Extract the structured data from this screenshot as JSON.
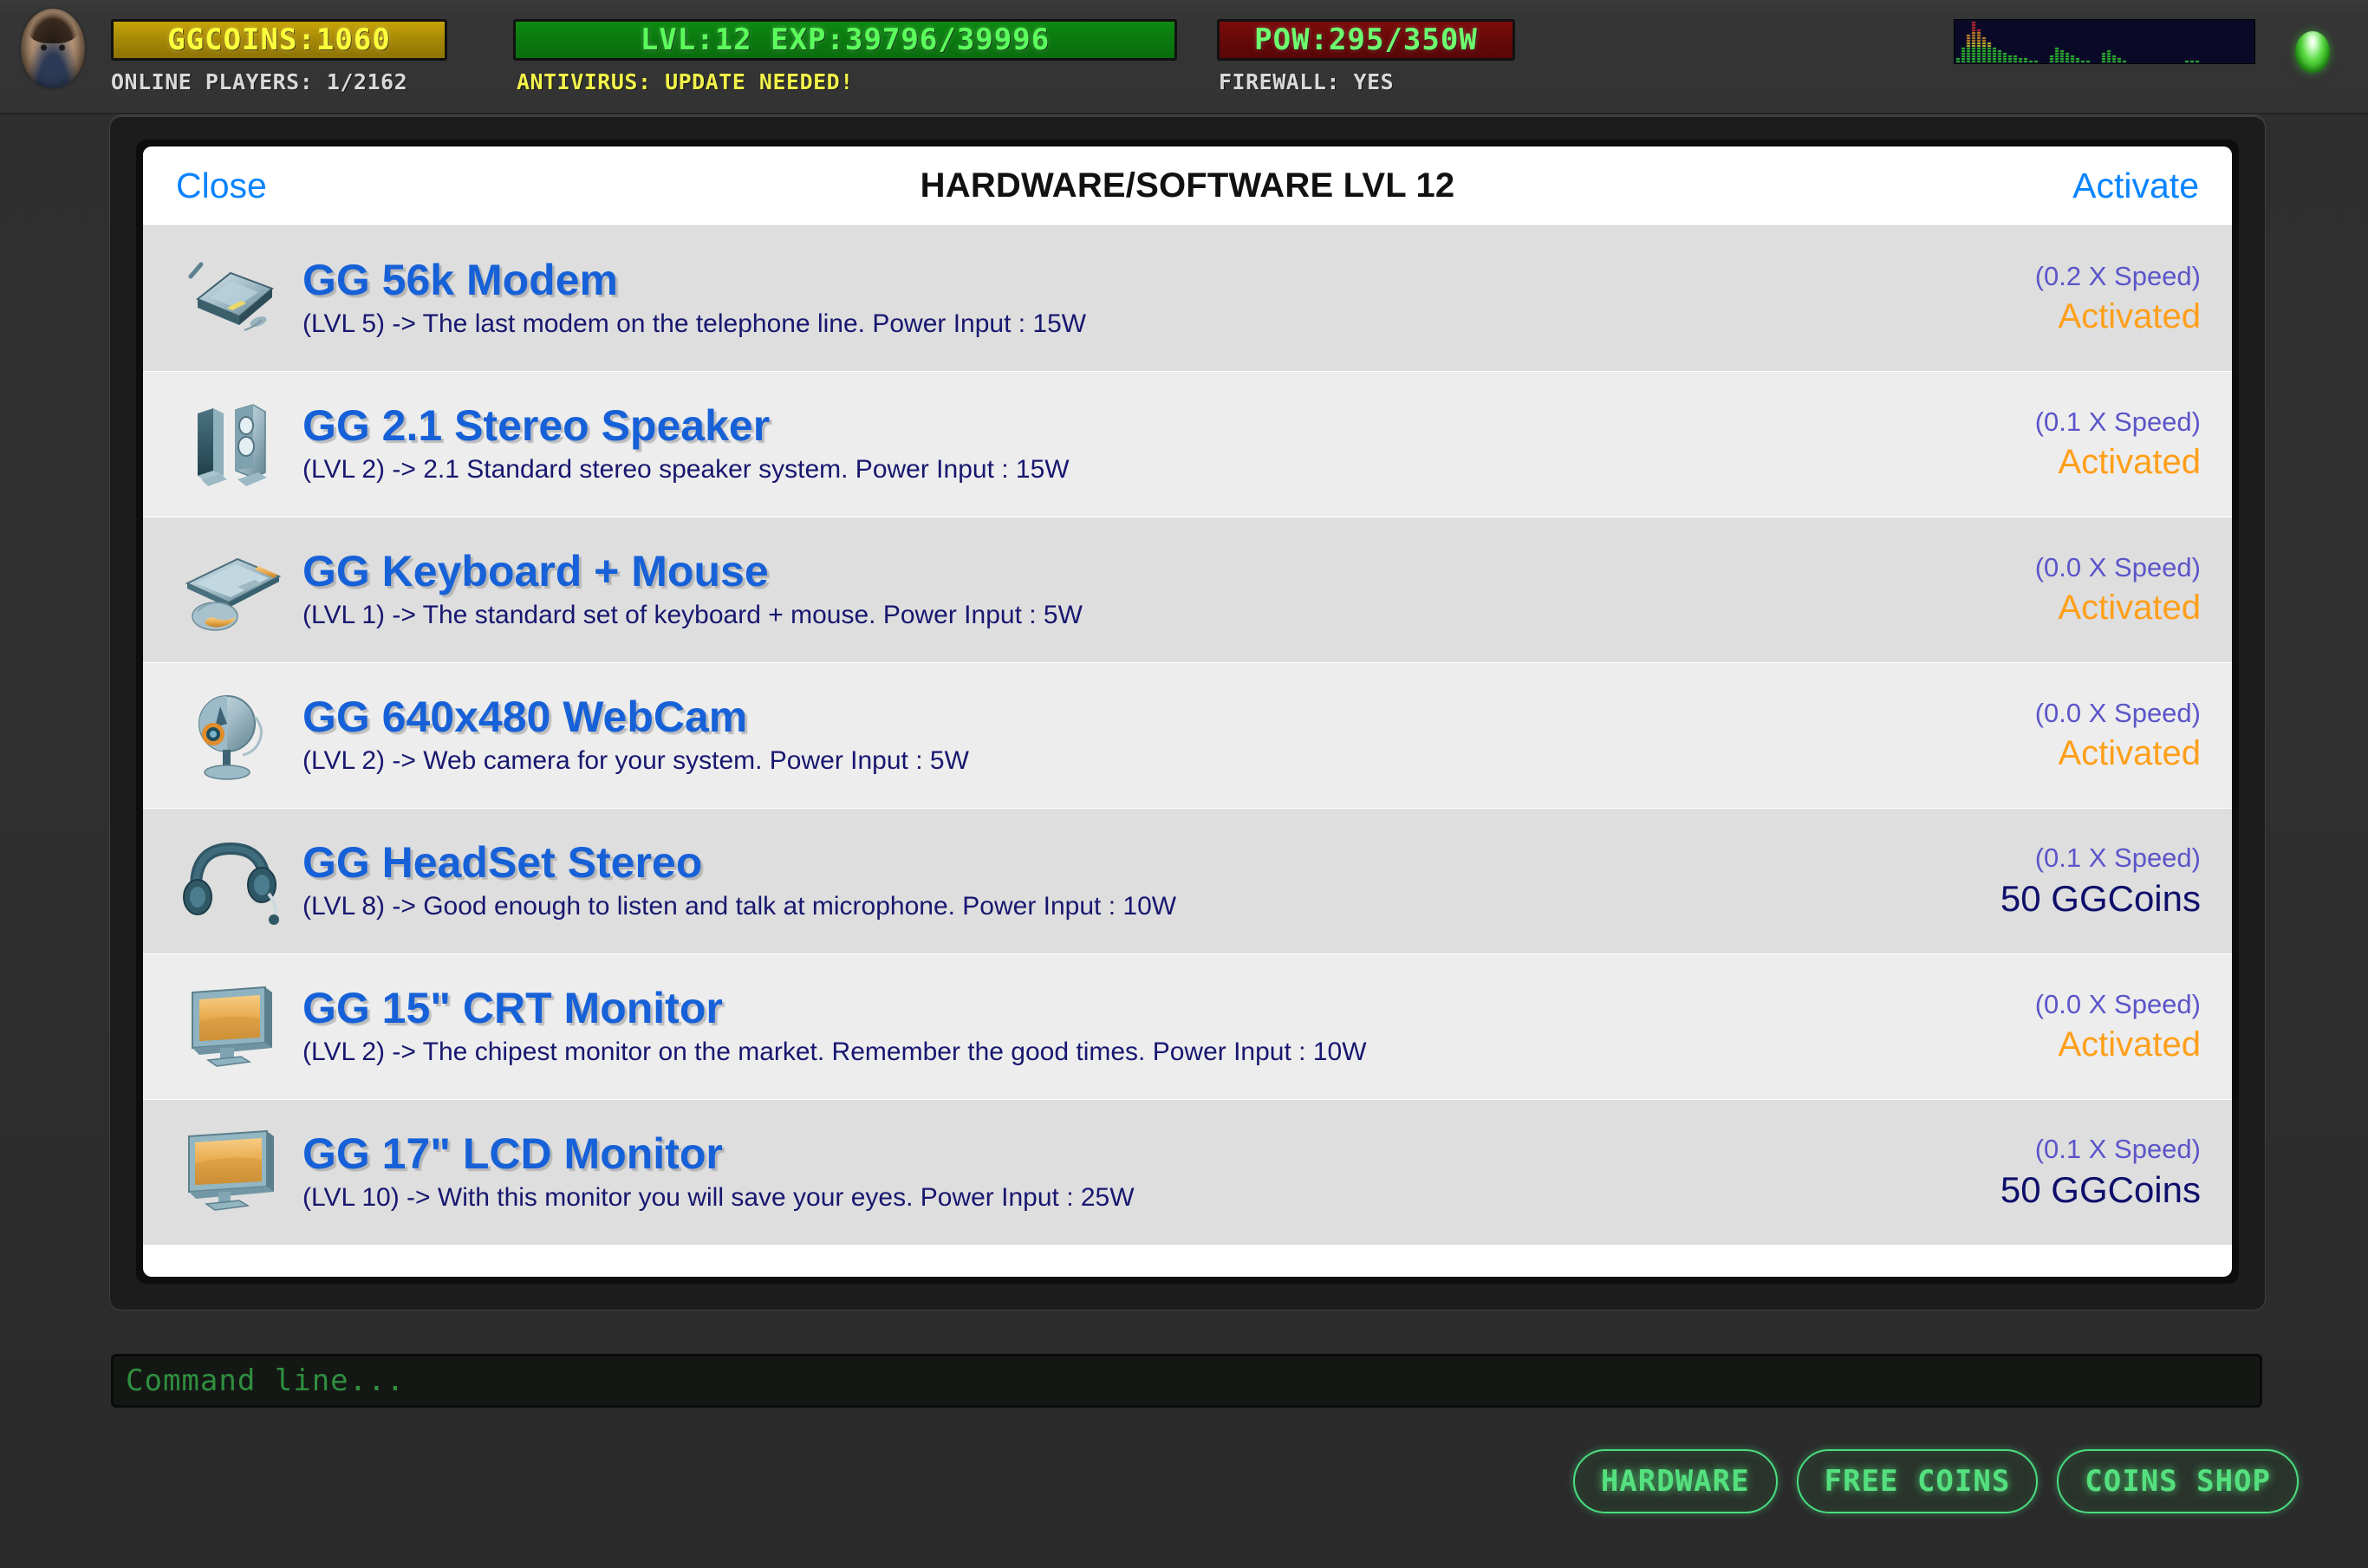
{
  "hud": {
    "avatar_name": "player-avatar",
    "coins_meter": "GGCOINS:1060",
    "level_meter": "LVL:12   EXP:39796/39996",
    "power_meter": "POW:295/350W",
    "online_players": "ONLINE PLAYERS: 1/2162",
    "antivirus": "ANTIVIRUS: UPDATE NEEDED!",
    "firewall": "FIREWALL: YES",
    "colors": {
      "coins_bg": "#c8a308",
      "coins_text": "#fbff3a",
      "level_bg": "#0e8a12",
      "level_text": "#5bff5b",
      "power_bg": "#7d0c0c",
      "power_text": "#6eff6e",
      "antivirus_text": "#f2f24a",
      "led": "#3fcc2a"
    },
    "spectrum_label": "network-spectrum-graph",
    "led_label": "connection-status-led"
  },
  "modal": {
    "close_label": "Close",
    "title": "HARDWARE/SOFTWARE LVL 12",
    "activate_label": "Activate",
    "items": [
      {
        "icon": "modem-icon",
        "title": "GG 56k Modem",
        "description": "(LVL 5) -> The last modem on the telephone line. Power Input : 15W",
        "speed": "(0.2 X Speed)",
        "status": "Activated",
        "status_kind": "activated"
      },
      {
        "icon": "speaker-icon",
        "title": "GG 2.1 Stereo Speaker",
        "description": "(LVL 2) -> 2.1 Standard stereo speaker system. Power Input : 15W",
        "speed": "(0.1 X Speed)",
        "status": "Activated",
        "status_kind": "activated"
      },
      {
        "icon": "keyboard-mouse-icon",
        "title": "GG Keyboard + Mouse",
        "description": "(LVL 1) -> The standard set of keyboard + mouse. Power Input : 5W",
        "speed": "(0.0 X Speed)",
        "status": "Activated",
        "status_kind": "activated"
      },
      {
        "icon": "webcam-icon",
        "title": "GG 640x480 WebCam",
        "description": "(LVL 2) -> Web camera for your system. Power Input : 5W",
        "speed": "(0.0 X Speed)",
        "status": "Activated",
        "status_kind": "activated"
      },
      {
        "icon": "headset-icon",
        "title": "GG HeadSet Stereo",
        "description": "(LVL 8) -> Good enough to listen and talk at microphone. Power Input : 10W",
        "speed": "(0.1 X Speed)",
        "status": "50 GGCoins",
        "status_kind": "price"
      },
      {
        "icon": "crt-monitor-icon",
        "title": "GG 15\" CRT Monitor",
        "description": "(LVL 2) -> The chipest monitor on the market. Remember the good times. Power Input : 10W",
        "speed": "(0.0 X Speed)",
        "status": "Activated",
        "status_kind": "activated"
      },
      {
        "icon": "lcd-monitor-icon",
        "title": "GG 17\" LCD Monitor",
        "description": "(LVL 10) -> With this monitor you will save your eyes. Power Input : 25W",
        "speed": "(0.1 X Speed)",
        "status": "50 GGCoins",
        "status_kind": "price"
      }
    ]
  },
  "command_line": {
    "placeholder": "Command line...",
    "value": ""
  },
  "bottom_buttons": [
    {
      "label": "HARDWARE",
      "name": "hardware-button"
    },
    {
      "label": "FREE COINS",
      "name": "free-coins-button"
    },
    {
      "label": "COINS SHOP",
      "name": "coins-shop-button"
    }
  ]
}
